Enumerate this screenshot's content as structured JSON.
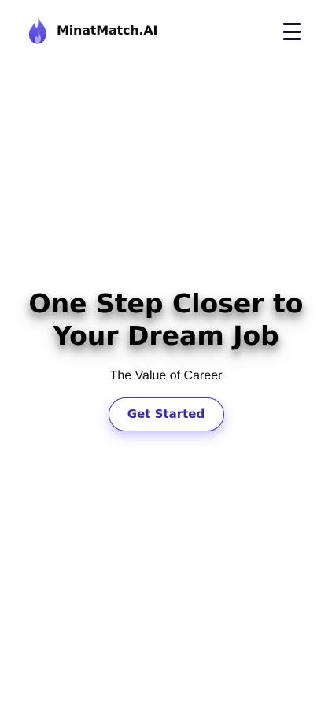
{
  "header": {
    "brand_name": "MinatMatch.AI",
    "logo_icon": "flame-icon",
    "menu_icon": "hamburger-menu-icon"
  },
  "hero": {
    "title": "One Step Closer to Your Dream Job",
    "subtitle": "The Value of Career",
    "cta_label": "Get Started"
  },
  "colors": {
    "accent": "#4a3aa8",
    "logo_flame": "#6c5ce7",
    "text": "#000000",
    "background": "#ffffff"
  }
}
